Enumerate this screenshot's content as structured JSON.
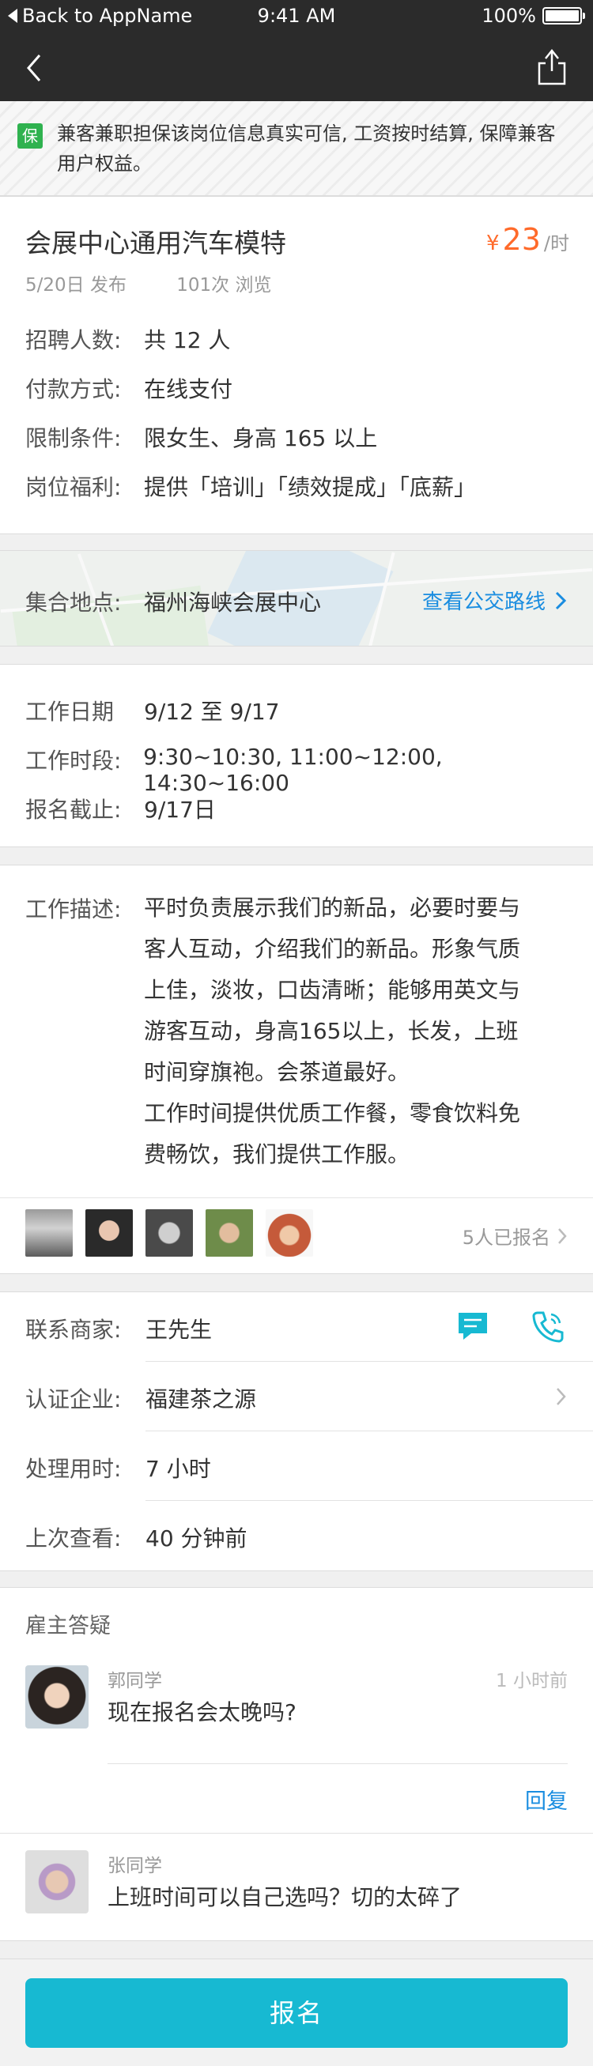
{
  "status_bar": {
    "back_label": "Back to AppName",
    "time": "9:41 AM",
    "battery": "100%",
    "battery_level": 1.0
  },
  "navbar": {
    "back_icon": "chevron-left-icon",
    "share_icon": "share-icon"
  },
  "notice": {
    "badge": "保",
    "text": "兼客兼职担保该岗位信息真实可信, 工资按时结算, 保障兼客用户权益。"
  },
  "job": {
    "title": "会展中心通用汽车模特",
    "price_symbol": "¥",
    "price": "23",
    "price_unit": "/时",
    "posted": "5/20日 发布",
    "views": "101次 浏览",
    "details": [
      {
        "label": "招聘人数:",
        "value": "共 12 人"
      },
      {
        "label": "付款方式:",
        "value": "在线支付"
      },
      {
        "label": "限制条件:",
        "value": "限女生、身高 165 以上"
      },
      {
        "label": "岗位福利:",
        "value": "提供「培训」「绩效提成」「底薪」"
      }
    ]
  },
  "location": {
    "label": "集合地点:",
    "address": "福州海峡会展中心",
    "route_link": "查看公交路线"
  },
  "schedule": [
    {
      "label": "工作日期",
      "value": "9/12 至 9/17"
    },
    {
      "label": "工作时段:",
      "value": "9:30~10:30, 11:00~12:00, 14:30~16:00"
    },
    {
      "label": "报名截止:",
      "value": "9/17日"
    }
  ],
  "description": {
    "label": "工作描述:",
    "line1": "平时负责展示我们的新品，必要时要与",
    "line2": "客人互动，介绍我们的新品。形象气质",
    "line3": "上佳，淡妆，口齿清晰；能够用英文与",
    "line4": "游客互动，身高165以上，长发，上班",
    "line5": "时间穿旗袍。会茶道最好。",
    "line6": "工作时间提供优质工作餐，零食饮料免",
    "line7": "费畅饮，我们提供工作服。"
  },
  "applicants": {
    "count_label": "5人已报名"
  },
  "contact": {
    "merchant_label": "联系商家:",
    "merchant": "王先生",
    "company_label": "认证企业:",
    "company": "福建茶之源",
    "process_label": "处理用时:",
    "process": "7 小时",
    "last_seen_label": "上次查看:",
    "last_seen": "40 分钟前"
  },
  "qa": {
    "title": "雇主答疑",
    "items": [
      {
        "name": "郭同学",
        "time": "1 小时前",
        "question": "现在报名会太晚吗?"
      },
      {
        "name": "张同学",
        "time": "",
        "question": "上班时间可以自己选吗？切的太碎了"
      }
    ],
    "reply_label": "回复"
  },
  "signup_button": "报名",
  "colors": {
    "accent": "#17b9d2",
    "price": "#ff6a2a",
    "link": "#1a8de0",
    "badge": "#2fb24f",
    "bar": "#2b2b2b"
  }
}
